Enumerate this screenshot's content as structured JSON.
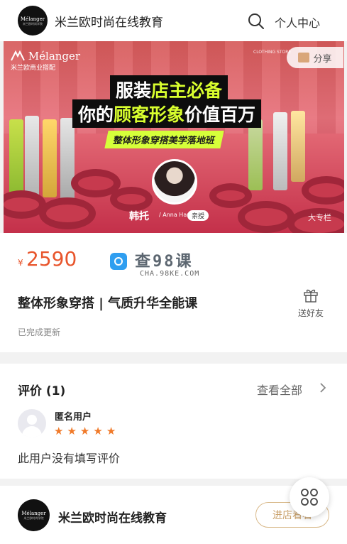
{
  "header": {
    "logo_text": "Mélanger",
    "logo_sub": "米兰欧时尚学院",
    "shop_name": "米兰欧时尚在线教育",
    "search_icon": "search-icon",
    "personal_center": "个人中心"
  },
  "banner": {
    "brand_name": "Mélanger",
    "brand_sub": "米兰欧商业搭配",
    "store_sign": "CLOTHING STORE",
    "share_label": "分享",
    "headline_1_a": "服装",
    "headline_1_b": "店主必备",
    "headline_2_a": "你的",
    "headline_2_b": "顾客形象",
    "headline_2_c": "价值百万",
    "subline": "整体形象穿搭美学落地班",
    "teacher_name": "韩托",
    "teacher_en": "/ Anna Han",
    "teacher_tag": "亲授",
    "column_tag": "大专栏"
  },
  "course": {
    "currency": "¥",
    "price": "2590",
    "watermark_title": "查98课",
    "watermark_url": "CHA.98KE.COM",
    "title": "整体形象穿搭 | 气质升华全能课",
    "gift_label": "送好友",
    "status": "已完成更新"
  },
  "reviews": {
    "title": "评价 (1)",
    "view_all": "查看全部",
    "items": [
      {
        "user": "匿名用户",
        "rating": 5,
        "text": "此用户没有填写评价"
      }
    ]
  },
  "shop_bar": {
    "logo_text": "Mélanger",
    "logo_sub": "米兰欧时尚学院",
    "name": "米兰欧时尚在线教育",
    "enter_label": "进店看看"
  },
  "colors": {
    "price": "#e8552c",
    "star": "#f07a2a",
    "headline_highlight": "#d9ff2e",
    "enter_border": "#d9b98a"
  }
}
